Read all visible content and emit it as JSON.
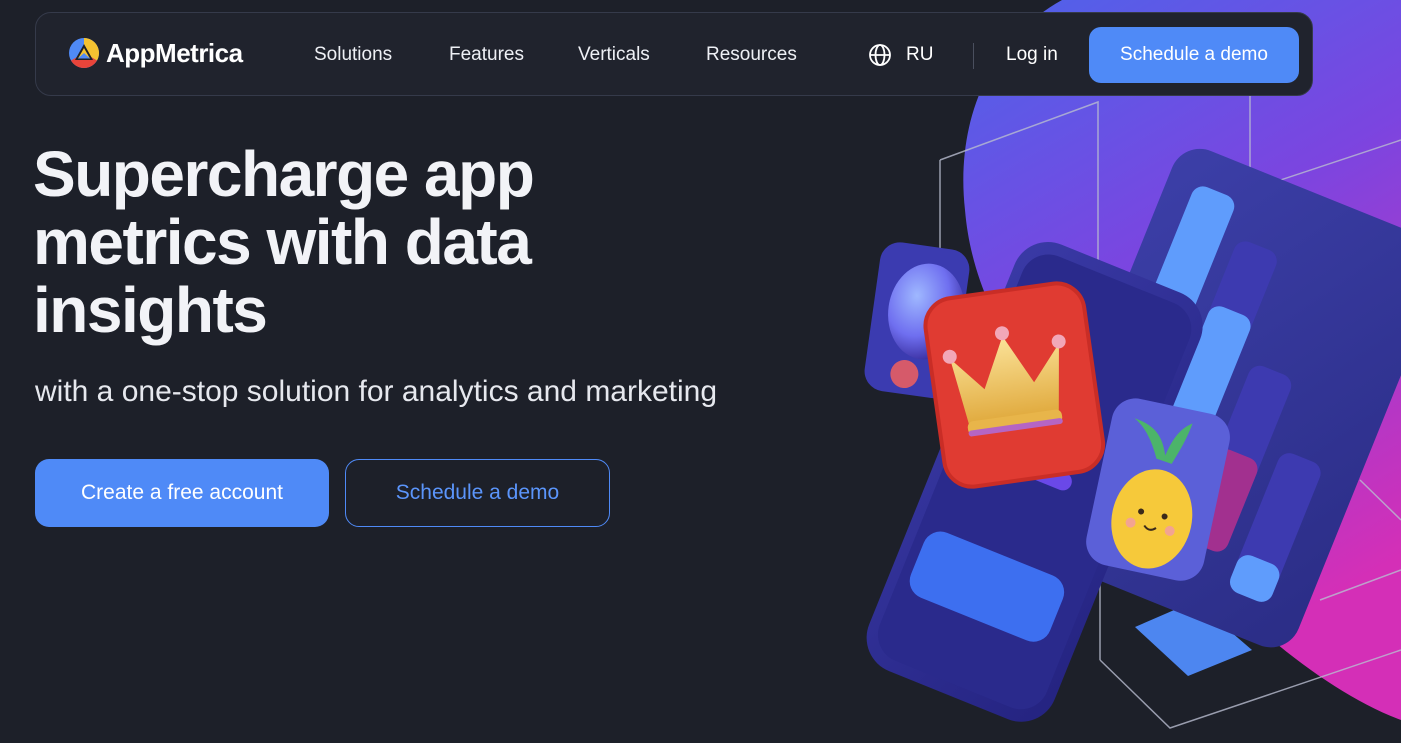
{
  "header": {
    "logo_text": "AppMetrica",
    "nav": [
      "Solutions",
      "Features",
      "Verticals",
      "Resources"
    ],
    "language": "RU",
    "login_label": "Log in",
    "cta_label": "Schedule a demo"
  },
  "hero": {
    "title": "Supercharge app metrics with data insights",
    "subtitle": "with a one-stop solution for analytics and marketing",
    "primary_cta": "Create a free account",
    "secondary_cta": "Schedule a demo"
  },
  "colors": {
    "background": "#1d2029",
    "accent": "#4f8af7",
    "gradient_start": "#4e63e9",
    "gradient_end": "#d42fb7"
  },
  "icons": {
    "globe": "globe-icon",
    "logo": "appmetrica-logo-icon",
    "crown": "crown-icon",
    "pineapple": "pineapple-icon"
  }
}
